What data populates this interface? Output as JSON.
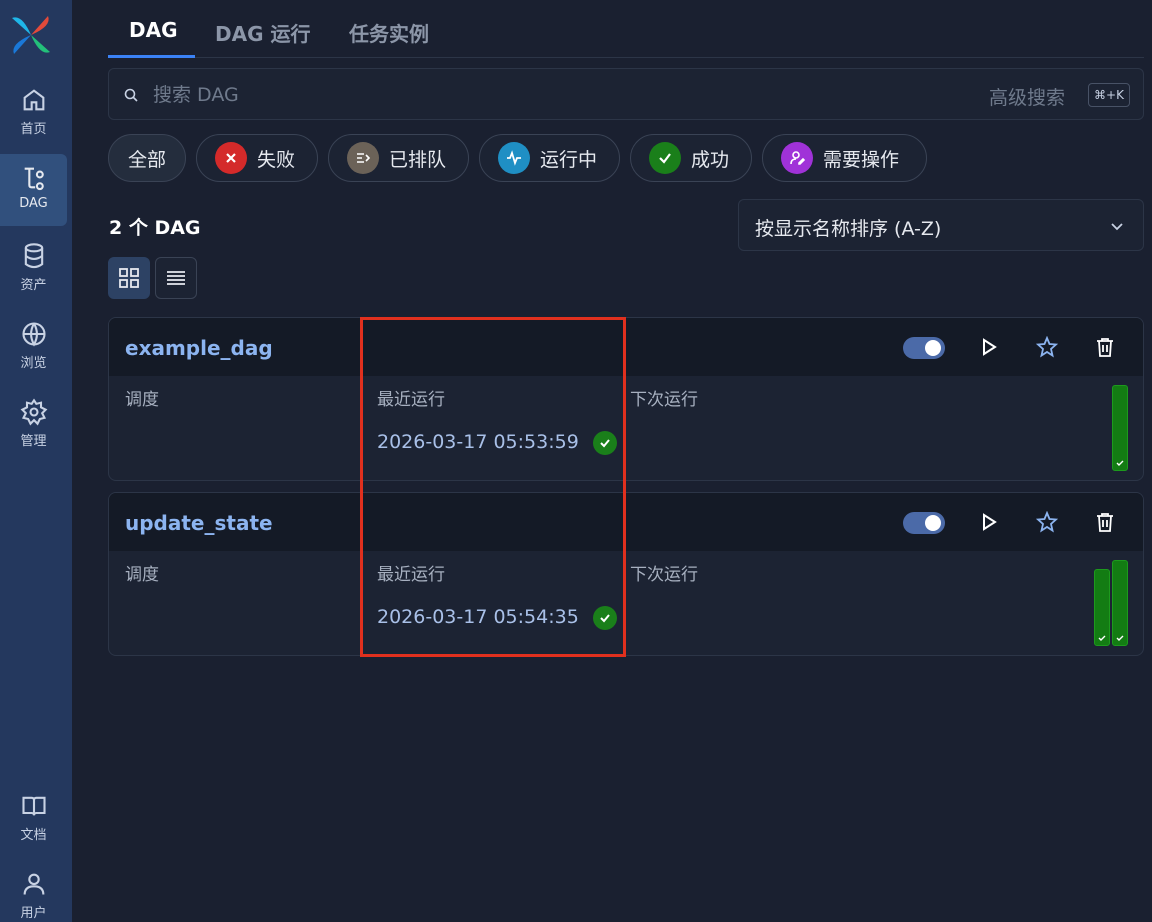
{
  "sidebar": {
    "items": [
      {
        "label": "首页",
        "icon": "home-icon"
      },
      {
        "label": "DAG",
        "icon": "dag-icon",
        "active": true
      },
      {
        "label": "资产",
        "icon": "database-icon"
      },
      {
        "label": "浏览",
        "icon": "globe-icon"
      },
      {
        "label": "管理",
        "icon": "gear-icon"
      },
      {
        "label": "文档",
        "icon": "book-icon"
      },
      {
        "label": "用户",
        "icon": "user-icon"
      }
    ]
  },
  "tabs": [
    {
      "label": "DAG",
      "active": true
    },
    {
      "label": "DAG 运行"
    },
    {
      "label": "任务实例"
    }
  ],
  "search": {
    "placeholder": "搜索 DAG",
    "value": "",
    "advanced_label": "高级搜索",
    "shortcut": "⌘+K"
  },
  "filters": [
    {
      "label": "全部",
      "icon": null
    },
    {
      "label": "失败",
      "icon": "x-icon",
      "color": "#d42a2a"
    },
    {
      "label": "已排队",
      "icon": "queue-icon",
      "color": "#6b6258"
    },
    {
      "label": "运行中",
      "icon": "pulse-icon",
      "color": "#1f8fc4"
    },
    {
      "label": "成功",
      "icon": "check-icon",
      "color": "#1a7f1a"
    },
    {
      "label": "需要操作",
      "icon": "user-action-icon",
      "color": "#a032d8"
    }
  ],
  "dag_count": "2 个 DAG",
  "sort": {
    "label": "按显示名称排序 (A-Z)"
  },
  "dags": [
    {
      "name": "example_dag",
      "schedule_label": "调度",
      "last_run_label": "最近运行",
      "last_run": "2026-03-17 05:53:59",
      "last_run_status": "success",
      "next_run_label": "下次运行",
      "enabled": true,
      "recent_runs": [
        "success"
      ]
    },
    {
      "name": "update_state",
      "schedule_label": "调度",
      "last_run_label": "最近运行",
      "last_run": "2026-03-17 05:54:35",
      "last_run_status": "success",
      "next_run_label": "下次运行",
      "enabled": true,
      "recent_runs": [
        "success",
        "success"
      ]
    }
  ],
  "colors": {
    "accent": "#3b82f6",
    "success": "#1a7f1a",
    "highlight": "#e0301e"
  }
}
